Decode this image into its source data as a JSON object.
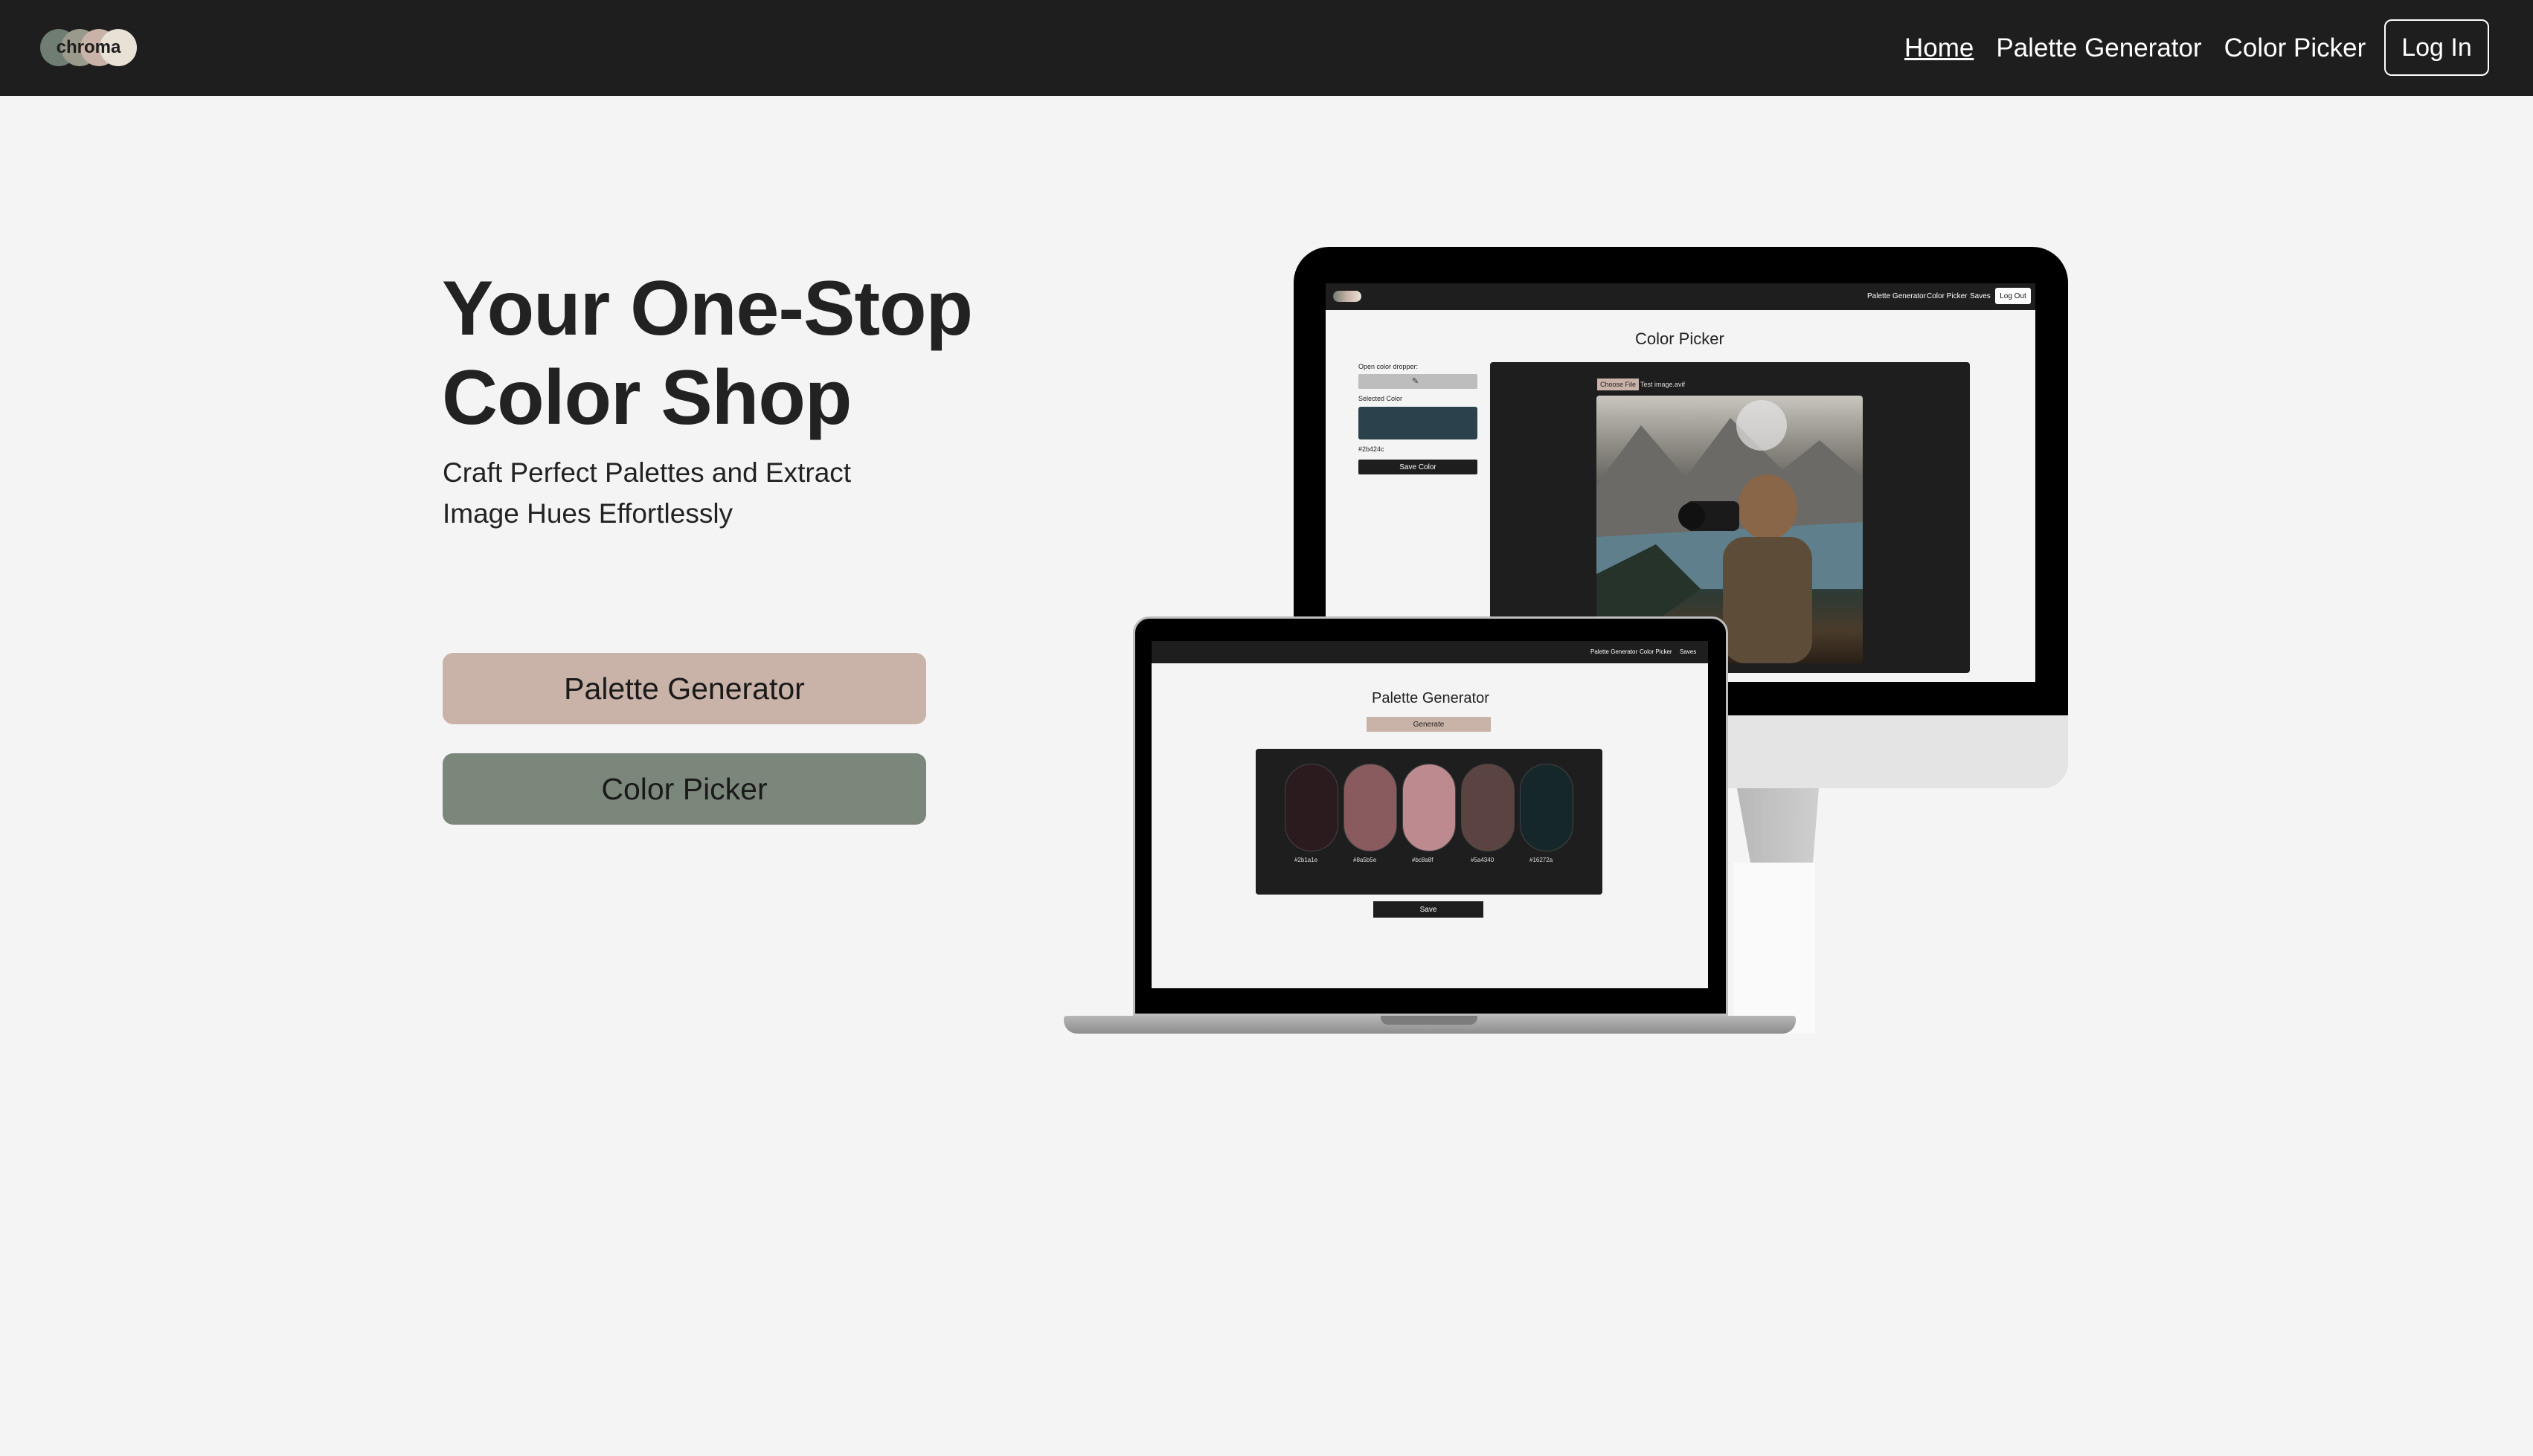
{
  "nav": {
    "logo_text": "chroma",
    "links": [
      "Home",
      "Palette Generator",
      "Color Picker"
    ],
    "login_label": "Log In"
  },
  "hero": {
    "title_line1": "Your One-Stop",
    "title_line2": "Color Shop",
    "subtitle_line1": "Craft Perfect Palettes and Extract",
    "subtitle_line2": "Image Hues Effortlessly",
    "palette_button": "Palette Generator",
    "picker_button": "Color Picker"
  },
  "colors": {
    "nav_bg": "#1e1e1e",
    "page_bg": "#f4f4f4",
    "palette_button_bg": "#c9b2a7",
    "picker_button_bg": "#7c877c",
    "logo_dots": [
      "#6f7d73",
      "#c9b2a7",
      "#e8e2d6"
    ]
  },
  "desktop_mockup": {
    "nav_links": [
      "Palette Generator",
      "Color Picker",
      "Saves"
    ],
    "logout_label": "Log Out",
    "heading": "Color Picker",
    "dropper_label": "Open color dropper:",
    "selected_label": "Selected Color",
    "selected_color": "#2b424c",
    "selected_hex": "#2b424c",
    "save_label": "Save Color",
    "file_button": "Choose File",
    "file_name": "Test image.avif",
    "photo_icon": "photographer-image"
  },
  "laptop_mockup": {
    "nav_links": [
      "Palette Generator",
      "Color Picker",
      "Saves"
    ],
    "heading": "Palette Generator",
    "generate_label": "Generate",
    "save_label": "Save",
    "swatches": [
      {
        "color": "#2b1a1e",
        "hex": "#2b1a1e"
      },
      {
        "color": "#8a5b5e",
        "hex": "#8a5b5e"
      },
      {
        "color": "#bc8a8f",
        "hex": "#bc8a8f"
      },
      {
        "color": "#5a4340",
        "hex": "#5a4340"
      },
      {
        "color": "#16272a",
        "hex": "#16272a"
      }
    ]
  }
}
